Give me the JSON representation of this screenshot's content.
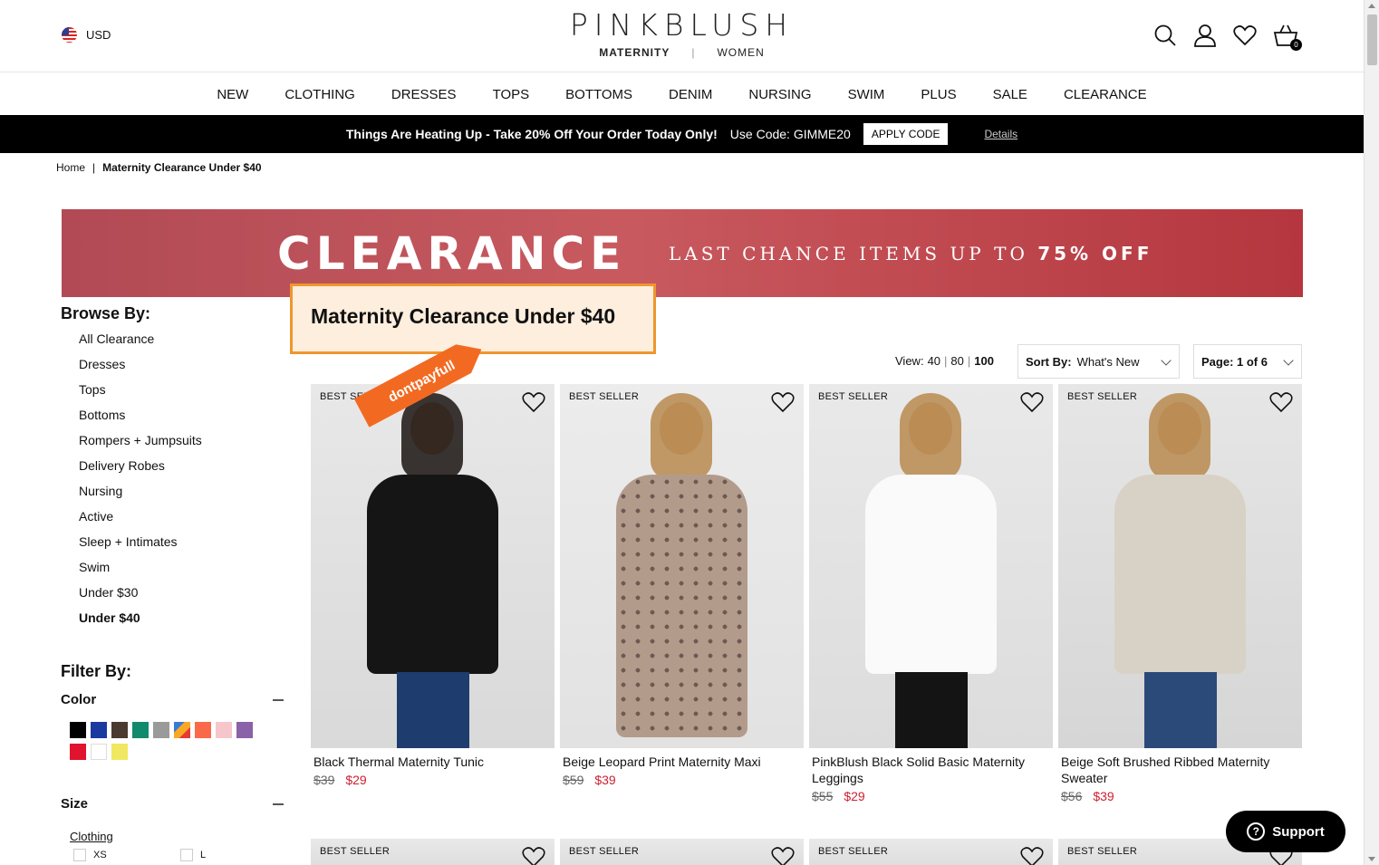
{
  "header": {
    "currency": "USD",
    "logo": "PINKBLUSH",
    "sub_active": "MATERNITY",
    "sub_sep": "|",
    "sub_other": "WOMEN",
    "cart_count": "0"
  },
  "nav": [
    "NEW",
    "CLOTHING",
    "DRESSES",
    "TOPS",
    "BOTTOMS",
    "DENIM",
    "NURSING",
    "SWIM",
    "PLUS",
    "SALE",
    "CLEARANCE"
  ],
  "promo": {
    "message": "Things Are Heating Up - Take 20% Off Your Order Today Only!",
    "code": "Use Code: GIMME20",
    "apply": "APPLY CODE",
    "details": "Details"
  },
  "breadcrumb": {
    "home": "Home",
    "sep": "|",
    "current": "Maternity Clearance Under $40"
  },
  "banner": {
    "title": "CLEARANCE",
    "subtitle": "LAST CHANCE ITEMS UP TO",
    "subtitle_bold": "75% OFF"
  },
  "page_title": "Maternity Clearance Under $40",
  "sidebar": {
    "browse_heading": "Browse By:",
    "browse_items": [
      "All Clearance",
      "Dresses",
      "Tops",
      "Bottoms",
      "Rompers + Jumpsuits",
      "Delivery Robes",
      "Nursing",
      "Active",
      "Sleep + Intimates",
      "Swim",
      "Under $30",
      "Under $40"
    ],
    "filter_heading": "Filter By:",
    "color_label": "Color",
    "colors": [
      "#000000",
      "#1a3aa0",
      "#4a3a30",
      "#128a6e",
      "#9a9a9a",
      "#ff6a3a",
      "#fa6a4a",
      "#f7c6cc",
      "#8a62a8",
      "#e0142e",
      "#ffffff",
      "#f0e860"
    ],
    "size_label": "Size",
    "size_group": "Clothing",
    "sizes": [
      "XS",
      "L"
    ]
  },
  "toolbar": {
    "view_label": "View:",
    "view_options": [
      "40",
      "80",
      "100"
    ],
    "sort_label": "Sort By:",
    "sort_value": "What's New",
    "page_value": "Page: 1 of 6"
  },
  "ribbon_text": "dontpayfull",
  "products": [
    {
      "badge": "BEST SELLER",
      "name": "Black Thermal Maternity Tunic",
      "old": "$39",
      "new": "$29"
    },
    {
      "badge": "BEST SELLER",
      "name": "Beige Leopard Print Maternity Maxi",
      "old": "$59",
      "new": "$39"
    },
    {
      "badge": "BEST SELLER",
      "name": "PinkBlush Black Solid Basic Maternity Leggings",
      "old": "$55",
      "new": "$29"
    },
    {
      "badge": "BEST SELLER",
      "name": "Beige Soft Brushed Ribbed Maternity Sweater",
      "old": "$56",
      "new": "$39"
    }
  ],
  "row2_badges": [
    "BEST SELLER",
    "BEST SELLER",
    "BEST SELLER",
    "BEST SELLER"
  ],
  "support": "Support"
}
